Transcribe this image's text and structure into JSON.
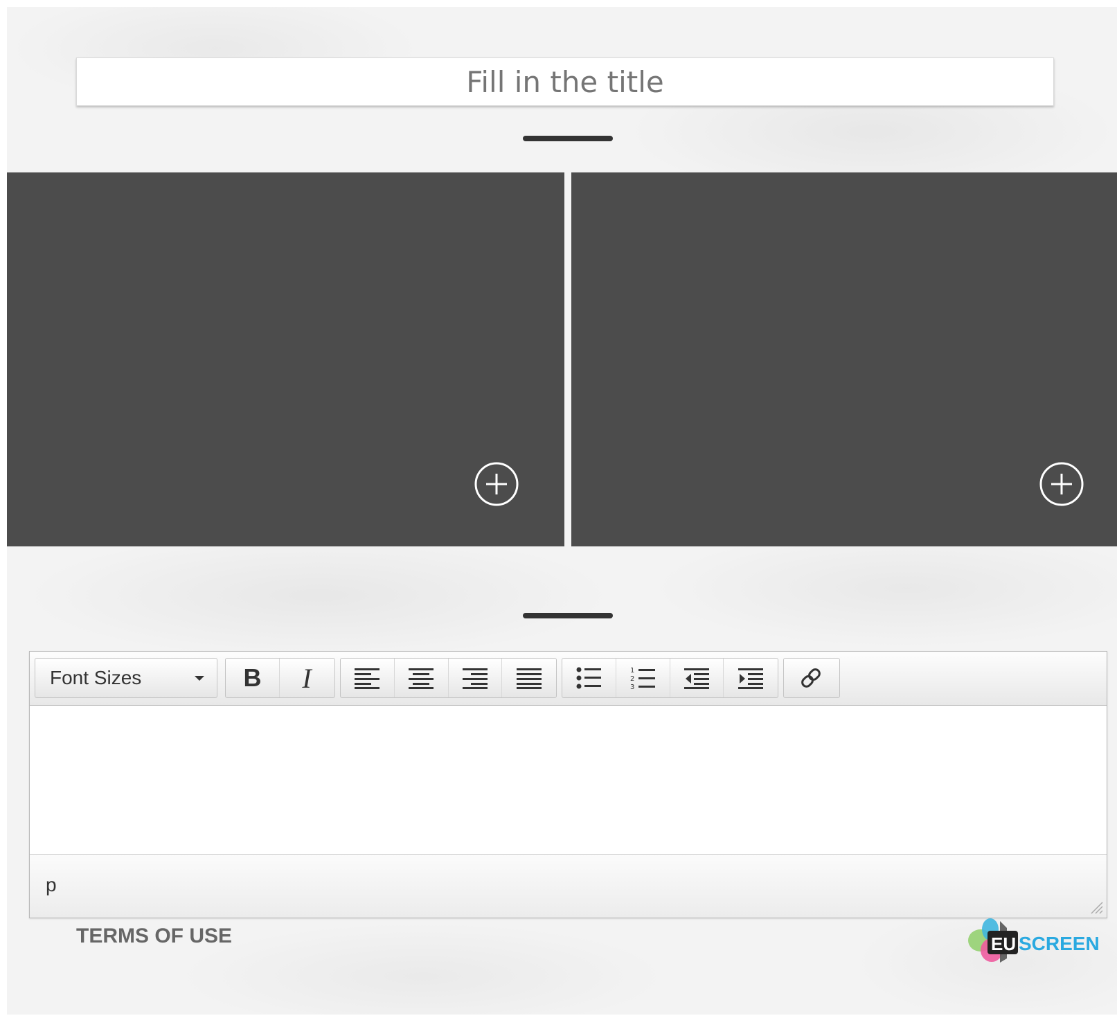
{
  "header": {
    "title_placeholder": "Fill in the title",
    "title_value": ""
  },
  "media_slots": [
    {
      "add_icon": "plus-circle-icon"
    },
    {
      "add_icon": "plus-circle-icon"
    }
  ],
  "editor": {
    "toolbar": {
      "font_sizes_label": "Font Sizes",
      "bold_label": "B",
      "italic_label": "I",
      "buttons": [
        "align-left-icon",
        "align-center-icon",
        "align-right-icon",
        "align-justify-icon",
        "bullet-list-icon",
        "numbered-list-icon",
        "outdent-icon",
        "indent-icon",
        "link-icon"
      ]
    },
    "content": "",
    "statusbar_path": "p"
  },
  "footer": {
    "terms_label": "TERMS OF USE",
    "logo_text_eu": "EU",
    "logo_text_screen": "SCREEN"
  },
  "colors": {
    "background": "#f3f3f3",
    "media_slot": "#4c4c4c",
    "logo_blue": "#2aa9e0"
  }
}
